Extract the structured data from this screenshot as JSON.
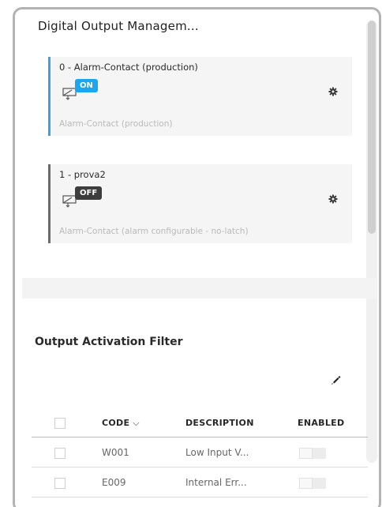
{
  "card": {
    "title": "Digital Output Managem..."
  },
  "outputs": [
    {
      "name": "0 - Alarm-Contact (production)",
      "state": "ON",
      "description": "Alarm-Contact (production)",
      "accent_color": "#1aa7f2",
      "icon": "relay-output-icon",
      "settings_icon": "gear-icon"
    },
    {
      "name": "1 - prova2",
      "state": "OFF",
      "description": "Alarm-Contact (alarm configurable - no-latch)",
      "accent_color": "#3d3d3d",
      "icon": "relay-output-icon",
      "settings_icon": "gear-icon"
    }
  ],
  "filter": {
    "title": "Output Activation Filter",
    "edit_icon": "pencil-icon",
    "columns": {
      "code": "CODE",
      "description": "DESCRIPTION",
      "enabled": "ENABLED"
    },
    "sort_icon": "chevron-down-icon",
    "rows": [
      {
        "code": "W001",
        "description": "Low Input V...",
        "enabled": false
      },
      {
        "code": "E009",
        "description": "Internal Err...",
        "enabled": false
      }
    ]
  },
  "colors": {
    "accent": "#1aa7f2",
    "frame_border": "#b3b3b3",
    "item_background": "#f5f5f5"
  }
}
